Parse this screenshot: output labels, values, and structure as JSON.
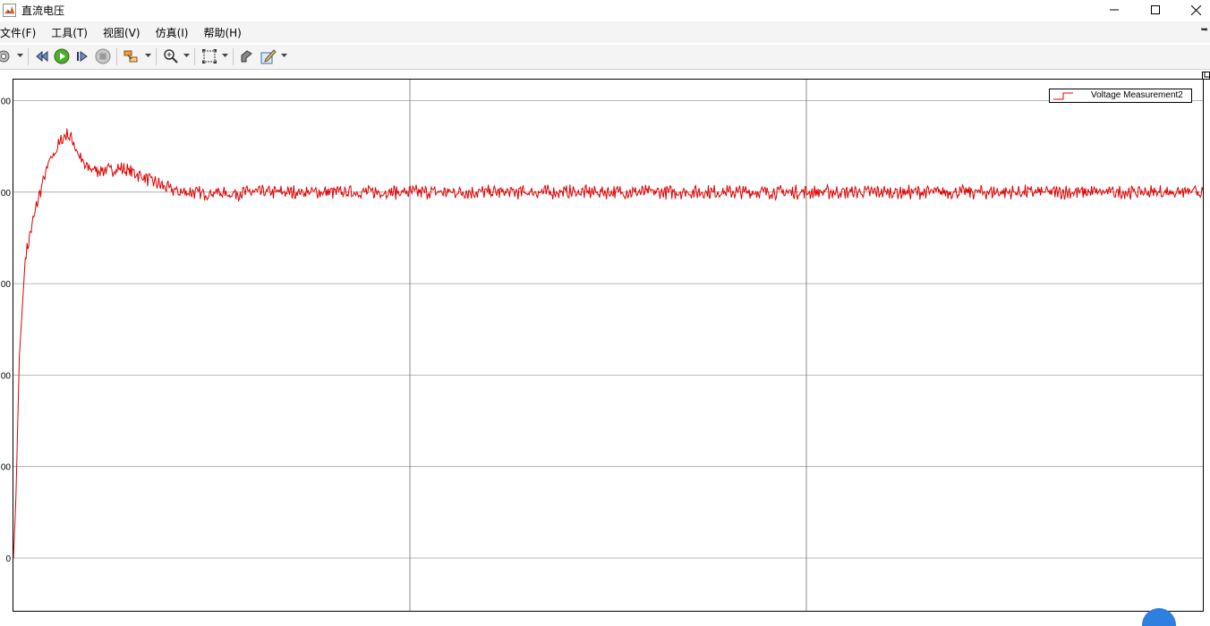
{
  "window": {
    "title": "直流电压",
    "controls": [
      "minimize",
      "maximize",
      "close"
    ]
  },
  "menu": {
    "items": [
      "文件(F)",
      "工具(T)",
      "视图(V)",
      "仿真(I)",
      "帮助(H)"
    ]
  },
  "toolbar": {
    "buttons": [
      "settings-icon",
      "step-back-icon",
      "run-icon",
      "step-forward-icon",
      "stop-icon",
      "highlight-block-icon",
      "zoom-in-icon",
      "fit-to-view-icon",
      "style-icon",
      "edit-icon"
    ]
  },
  "chart_data": {
    "type": "line",
    "title": "",
    "xlabel": "",
    "ylabel": "",
    "y_tick_labels": [
      "00",
      "00",
      "00",
      "00",
      "00",
      "0"
    ],
    "grid": true,
    "legend_position": "top-right",
    "series": [
      {
        "name": "Voltage Measurement2",
        "color": "#e00000",
        "x": [
          0,
          0.002,
          0.005,
          0.01,
          0.015,
          0.02,
          0.025,
          0.03,
          0.035,
          0.04,
          0.045,
          0.05,
          0.055,
          0.06,
          0.07,
          0.08,
          0.09,
          0.1,
          0.11,
          0.12,
          0.13,
          0.14,
          0.15,
          0.16,
          0.17,
          0.18,
          0.2,
          0.25,
          0.3,
          0.35,
          0.4,
          0.45,
          0.5,
          0.55,
          0.6,
          0.65,
          0.7,
          0.75,
          0.8,
          0.85,
          0.9,
          0.95,
          1.0
        ],
        "y": [
          0,
          0.15,
          0.55,
          0.82,
          0.9,
          0.97,
          1.03,
          1.08,
          1.11,
          1.14,
          1.16,
          1.14,
          1.1,
          1.07,
          1.06,
          1.06,
          1.065,
          1.055,
          1.04,
          1.025,
          1.01,
          1.0,
          1.0,
          0.995,
          1.0,
          0.995,
          1.0,
          1.0,
          1.0,
          1.0,
          1.0,
          1.0,
          1.0,
          1.0,
          1.0,
          1.0,
          1.0,
          1.0,
          1.0,
          1.0,
          1.0,
          1.0,
          1.0
        ]
      }
    ]
  }
}
